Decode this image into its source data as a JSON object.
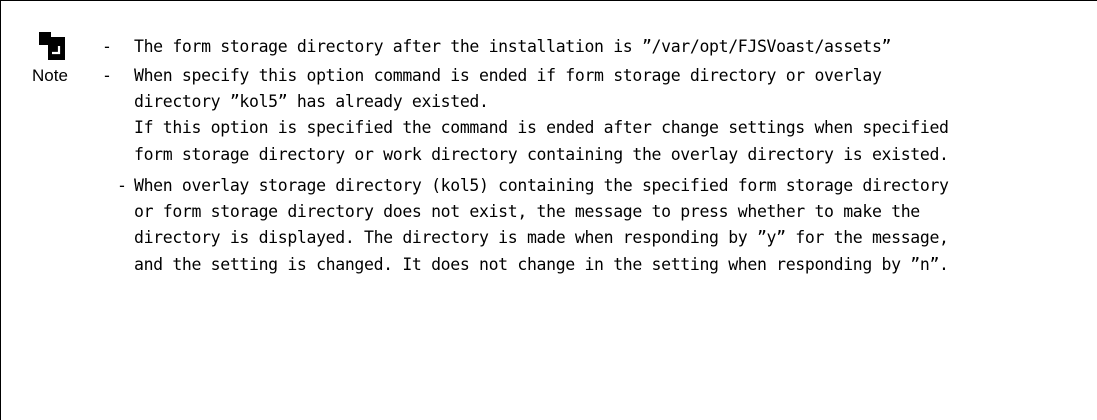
{
  "note": {
    "icon": "note-icon",
    "label": "Note",
    "items": [
      {
        "lines": [
          "The form storage directory after the installation is ”/var/opt/FJSVoast/assets”"
        ]
      },
      {
        "lines": [
          "When specify this option command is ended if form storage directory or overlay",
          "directory ”kol5” has already existed.",
          "If this option is specified the command is ended after change settings when specified",
          "form storage directory or work directory containing the overlay directory is existed."
        ]
      },
      {
        "lines": [
          "When overlay storage directory (kol5) containing the specified form storage directory",
          "or form storage directory does not exist, the message to press whether to make the",
          "directory is displayed. The directory is made when responding by ”y” for the message,",
          "and the setting is changed. It does not change in the setting when responding by ”n”."
        ]
      }
    ]
  }
}
